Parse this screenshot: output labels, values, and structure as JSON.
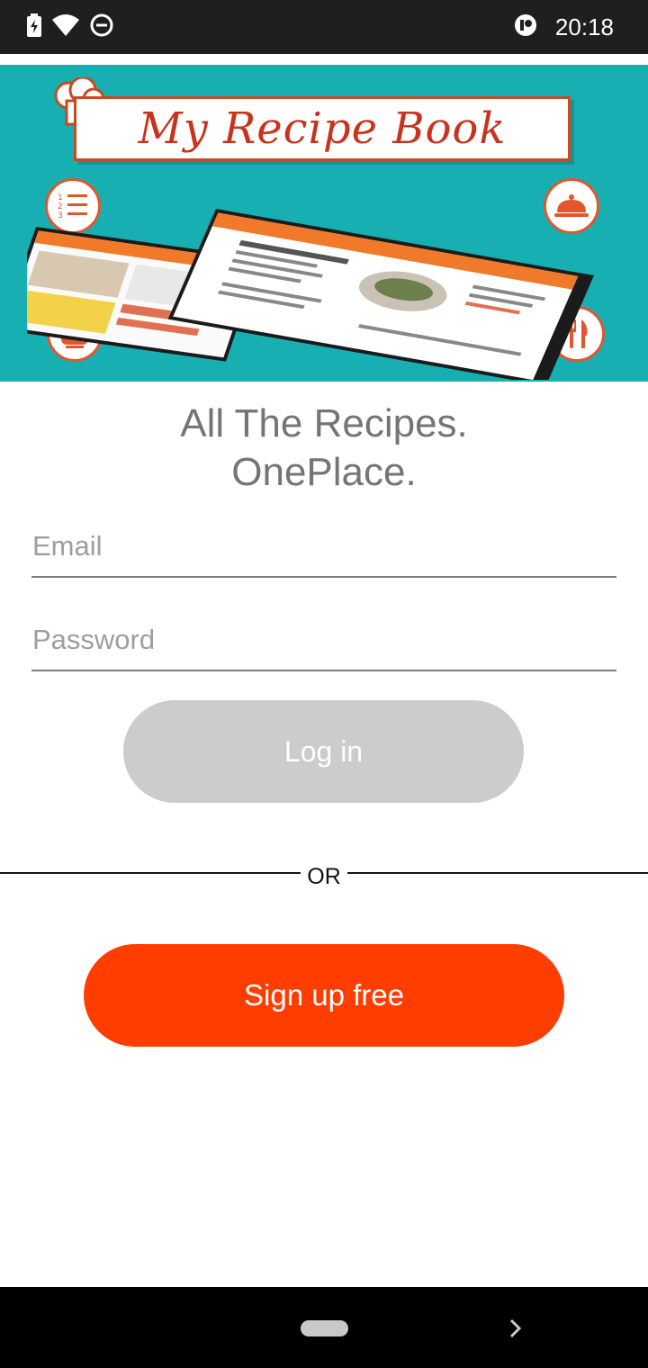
{
  "status_bar": {
    "time": "20:18",
    "icons": [
      "battery-charging-icon",
      "wifi-icon",
      "do-not-disturb-icon",
      "app-notification-icon"
    ]
  },
  "banner": {
    "title": "My Recipe Book",
    "icons": [
      "chef-hat-icon",
      "numbered-list-icon",
      "serving-cloche-icon",
      "cooking-pot-icon",
      "fork-knife-icon"
    ]
  },
  "tagline": {
    "line1": "All The Recipes.",
    "line2": "OnePlace."
  },
  "login_form": {
    "email_placeholder": "Email",
    "email_value": "",
    "password_placeholder": "Password",
    "password_value": "",
    "login_label": "Log in"
  },
  "divider": {
    "label": "OR"
  },
  "signup": {
    "label": "Sign up free"
  },
  "colors": {
    "status_bar_bg": "#1f1f1f",
    "banner_bg": "#17afb2",
    "accent_orange": "#ff3d00",
    "disabled_button": "#cccccc",
    "tagline_text": "#757575"
  },
  "nav_bar": {
    "icons": [
      "home-pill-icon",
      "chevron-right-icon"
    ]
  }
}
